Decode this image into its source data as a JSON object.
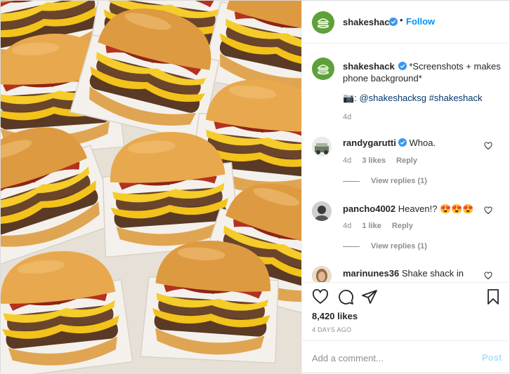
{
  "post": {
    "username": "shakeshack",
    "verified": true,
    "follow_label": "Follow",
    "separator": "•",
    "caption_text": "*Screenshots + makes phone background*",
    "caption_camera_emoji": "📷",
    "caption_mention": "@shakeshacksg",
    "caption_hashtag": "#shakeshack",
    "caption_colon": ":",
    "caption_time": "4d",
    "likes": "8,420 likes",
    "date": "4 DAYS AGO"
  },
  "comments": [
    {
      "username": "randygarutti",
      "verified": true,
      "text": "Whoa.",
      "time": "4d",
      "likes": "3 likes",
      "reply_label": "Reply",
      "view_replies": "View replies (1)"
    },
    {
      "username": "pancho4002",
      "verified": false,
      "text": "Heaven!? 😍😍😍",
      "time": "4d",
      "likes": "1 like",
      "reply_label": "Reply",
      "view_replies": "View replies (1)"
    },
    {
      "username": "marinunes36",
      "verified": false,
      "text": "Shake shack in"
    }
  ],
  "add_comment": {
    "placeholder": "Add a comment...",
    "post_label": "Post"
  },
  "icons": {
    "like": "heart-icon",
    "comment": "comment-icon",
    "share": "paper-plane-icon",
    "save": "bookmark-icon",
    "verified": "verified-badge-icon"
  },
  "colors": {
    "brand_green": "#5fa03a",
    "link_blue": "#0095f6",
    "verified_blue": "#3897f0",
    "muted": "#8e8e8e"
  }
}
